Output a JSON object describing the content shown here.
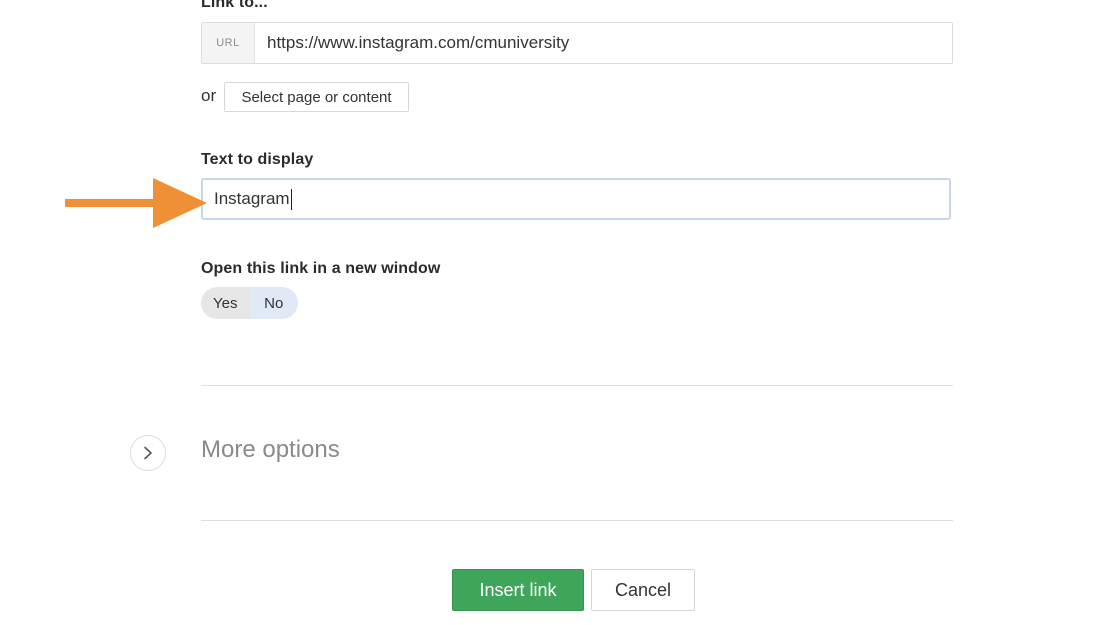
{
  "link_to": {
    "label": "Link to...",
    "url_addon": "URL",
    "url_value": "https://www.instagram.com/cmuniversity",
    "or_text": "or",
    "select_button": "Select page or content"
  },
  "text_to_display": {
    "label": "Text to display",
    "value": "Instagram"
  },
  "new_window": {
    "label": "Open this link in a new window",
    "options": [
      "Yes",
      "No"
    ],
    "selected": "No"
  },
  "more_options": {
    "label": "More options",
    "icon": "chevron-right-icon"
  },
  "actions": {
    "insert_label": "Insert link",
    "cancel_label": "Cancel"
  },
  "colors": {
    "accent_green": "#3ea55a",
    "annotation_arrow": "#ef9036",
    "focus_border": "#c9d7e8"
  }
}
